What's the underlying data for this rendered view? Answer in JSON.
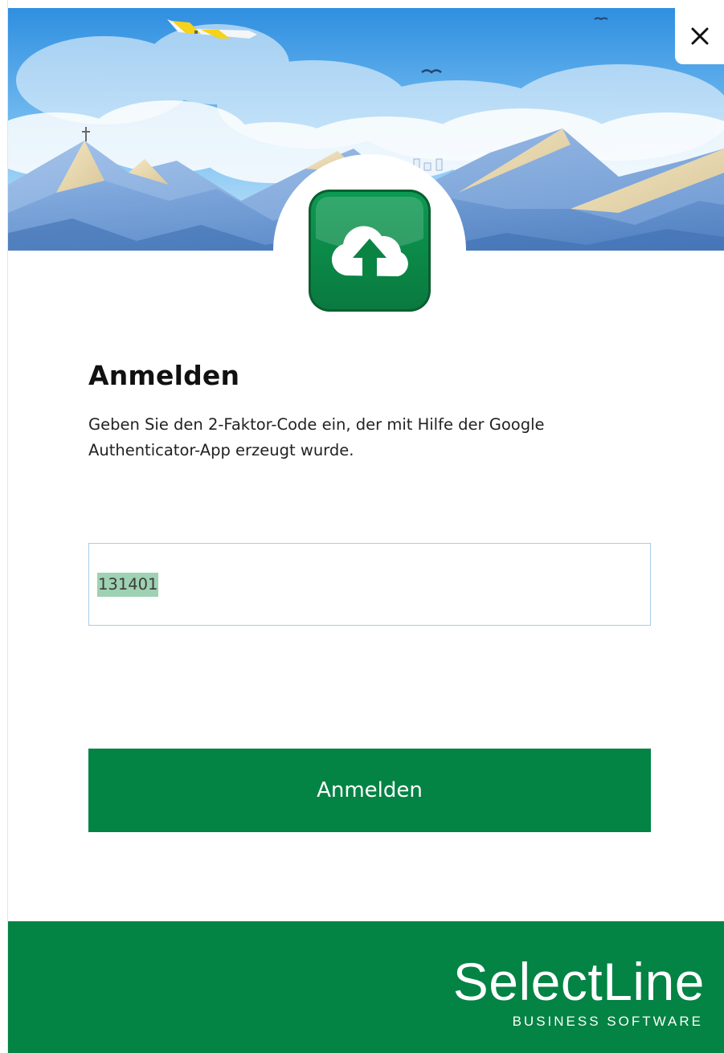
{
  "window": {
    "close_icon": "close-icon"
  },
  "header": {
    "app_icon": "cloud-upload-icon"
  },
  "login": {
    "title": "Anmelden",
    "description": "Geben Sie den 2-Faktor-Code ein, der mit Hilfe der Google Authenticator-App erzeugt wurde.",
    "code_value": "131401",
    "submit_label": "Anmelden"
  },
  "footer": {
    "brand_name": "SelectLine",
    "brand_tagline": "BUSINESS SOFTWARE"
  },
  "colors": {
    "brand_green": "#038344",
    "field_border": "#a9cde6",
    "selection": "#9fd1b3"
  }
}
